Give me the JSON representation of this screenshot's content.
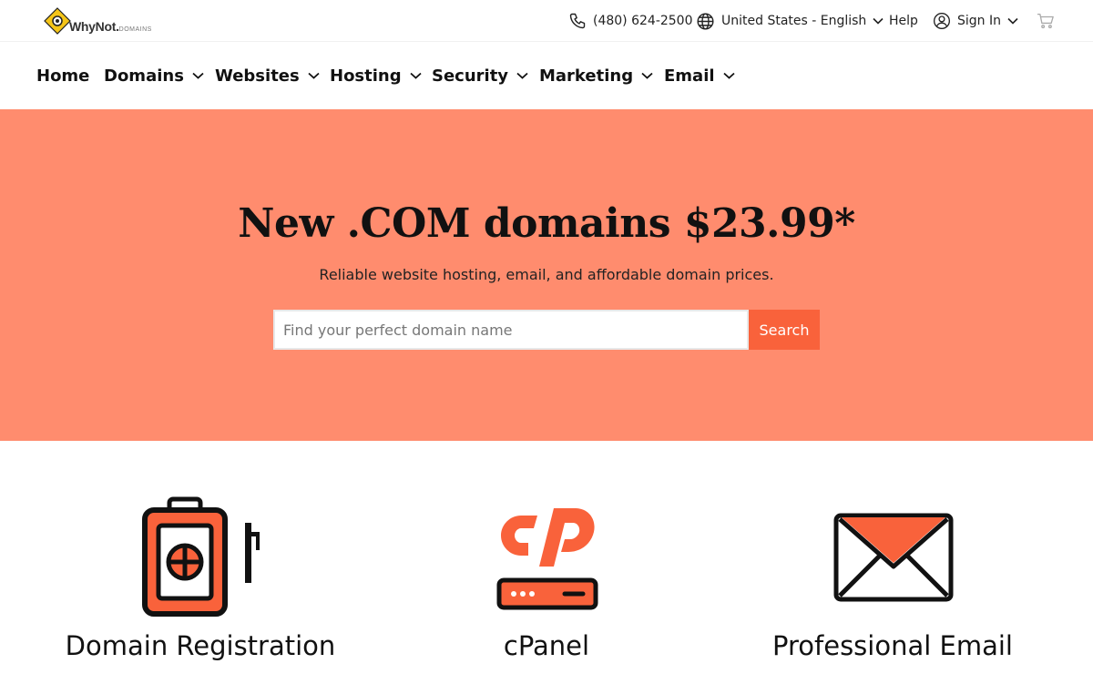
{
  "brand": {
    "name": "WhyNot.",
    "suffix": "DOMAINS",
    "accent": "#f9623b",
    "hero_bg": "#ff8c6e",
    "logo_color": "#f5c518"
  },
  "utility": {
    "phone": "(480) 624-2500",
    "locale": "United States - English",
    "help": "Help",
    "sign_in": "Sign In"
  },
  "nav": {
    "items": [
      {
        "label": "Home"
      },
      {
        "label": "Domains"
      },
      {
        "label": "Websites"
      },
      {
        "label": "Hosting"
      },
      {
        "label": "Security"
      },
      {
        "label": "Marketing"
      },
      {
        "label": "Email"
      }
    ]
  },
  "hero": {
    "title": "New .COM domains $23.99*",
    "subtitle": "Reliable website hosting, email, and affordable domain prices.",
    "search_placeholder": "Find your perfect domain name",
    "search_button": "Search"
  },
  "features": [
    {
      "label": "Domain Registration",
      "icon": "domain-registration-icon"
    },
    {
      "label": "cPanel",
      "icon": "cpanel-icon"
    },
    {
      "label": "Professional Email",
      "icon": "email-envelope-icon"
    }
  ]
}
